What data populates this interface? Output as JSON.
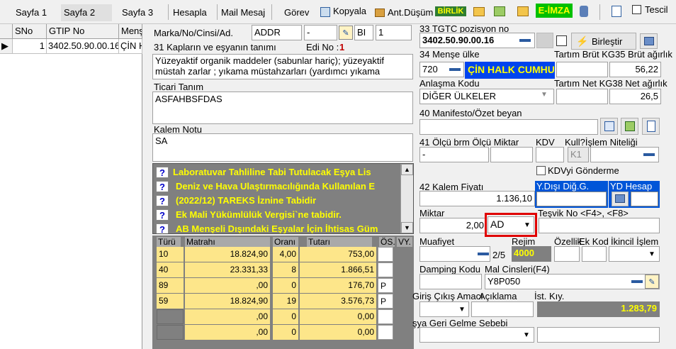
{
  "toolbar": {
    "tabs": [
      "Sayfa 1",
      "Sayfa 2",
      "Sayfa 3"
    ],
    "hesapla": "Hesapla",
    "mail": "Mail Mesaj",
    "gorev": "Görev",
    "kopyala": "Kopyala",
    "ant_dusum": "Ant.Düşüm",
    "birlik": "BİRLİK",
    "eimza": "E-İMZA",
    "tescil": "Tescil"
  },
  "grid": {
    "headers": [
      "SNo",
      "GTIP No",
      "Menş"
    ],
    "row": {
      "sno": "1",
      "gtip": "3402.50.90.00.16",
      "mense": "ÇİN H"
    }
  },
  "left": {
    "marka_label": "Marka/No/Cinsi/Ad.",
    "marka_value": "ADDR",
    "marka_dash": "-",
    "bi": "BI",
    "bi_value": "1",
    "kaplar_label": "31 Kapların ve eşyanın tanımı",
    "edi_label": "Edi No :",
    "edi_value": "1",
    "tanim": "Yüzeyaktif organik maddeler (sabunlar hariç); yüzeyaktif müstah zarlar ; yıkama müstahzarları (yardımcı yıkama",
    "ticari_label": "Ticari Tanım",
    "ticari_value": "ASFAHBSFDAS",
    "kalem_notu_label": "Kalem Notu",
    "kalem_notu_value": "SA"
  },
  "info_items": [
    "Laboratuvar Tahliline Tabi Tutulacak Eşya Lis",
    "Deniz ve Hava Ulaştırmacılığında Kullanılan E",
    "(2022/12) TAREKS İznine Tabidir",
    "Ek Mali Yükümlülük Vergisi`ne tabidir.",
    "AB Menşeli Dışındaki Eşyalar İçin İhtisas Güm"
  ],
  "tax": {
    "headers": [
      "Türü",
      "Matrahı",
      "Oranı",
      "Tutarı",
      "ÖS.",
      "VY."
    ],
    "rows": [
      {
        "tur": "10",
        "matrah": "18.824,90",
        "oran": "4,00",
        "tutar": "753,00",
        "os": ""
      },
      {
        "tur": "40",
        "matrah": "23.331,33",
        "oran": "8",
        "tutar": "1.866,51",
        "os": ""
      },
      {
        "tur": "89",
        "matrah": ",00",
        "oran": "0",
        "tutar": "176,70",
        "os": "P"
      },
      {
        "tur": "59",
        "matrah": "18.824,90",
        "oran": "19",
        "tutar": "3.576,73",
        "os": "P"
      },
      {
        "tur": "",
        "matrah": ",00",
        "oran": "0",
        "tutar": "0,00",
        "os": ""
      },
      {
        "tur": "",
        "matrah": ",00",
        "oran": "0",
        "tutar": "0,00",
        "os": ""
      }
    ]
  },
  "right": {
    "tgtc_label": "33 TGTC pozisyon no",
    "tgtc_value": "3402.50.90.00.16",
    "birlestir": "Birleştir",
    "mense_label": "34 Menşe ülke",
    "mense_code": "720",
    "mense_name": "ÇİN HALK CUMHU",
    "brut_label": "Tartım Brüt KG35 Brüt ağırlık",
    "brut_value": "56,22",
    "anlasma_label": "Anlaşma Kodu",
    "anlasma_value": "DİĞER ÜLKELER",
    "net_label": "Tartım Net KG38 Net ağırlık",
    "net_value": "26,5",
    "manifesto_label": "40 Manifesto/Özet beyan",
    "olcu_label": "41 Ölçü brm Ölçü Miktar",
    "kdv_label": "KDV",
    "kull_label": "Kull?İşlem Niteliği",
    "olcu_value": "-",
    "k1": "K1",
    "kdvyi": "KDVyi Gönderme",
    "kalem_fiyat_label": "42 Kalem Fiyatı",
    "kalem_fiyat_value": "1.136,10",
    "ydisi": "Y.Dışı Diğ.G.",
    "ydhesap": "YD Hesap",
    "miktar_label": "Miktar",
    "miktar_value": "2,00",
    "birim_value": "AD",
    "tesvik_label": "Teşvik No <F4>, <F8>",
    "muafiyet_label": "Muafiyet",
    "rejim_label": "Rejim",
    "ozellik_label": "Özellik",
    "ekkod_label": "Ek Kod",
    "ikincil_label": "İkincil İşlem",
    "muaf_count": "2/5",
    "rejim_value": "4000",
    "damping_label": "Damping Kodu",
    "mal_cinsleri_label": "Mal Cinsleri(F4)",
    "mal_cinsleri_value": "Y8P050",
    "giris_label": "Giriş Çıkış Amacı",
    "aciklama_label": "Açıklama",
    "ist_kiy_label": "İst. Kıy.",
    "ist_kiy_value": "1.283,79",
    "geri_label": "şya Geri Gelme Sebebi"
  }
}
